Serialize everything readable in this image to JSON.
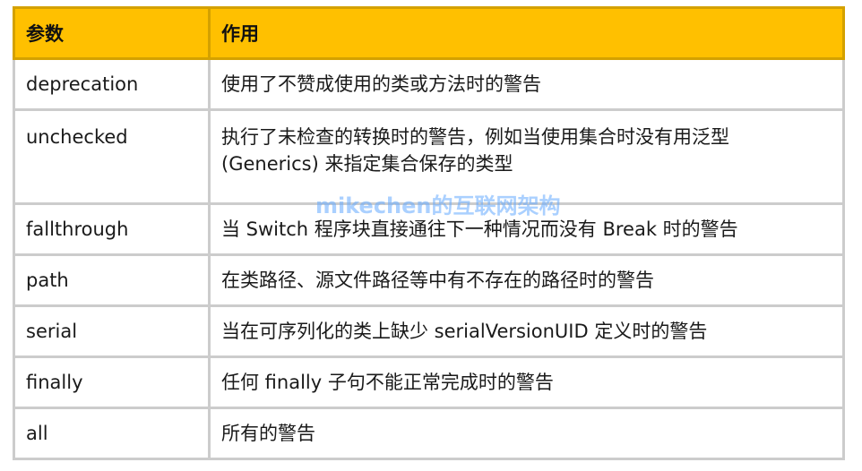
{
  "table": {
    "headers": [
      "参数",
      "作用"
    ],
    "rows": [
      {
        "param": "deprecation",
        "desc": "使用了不赞成使用的类或方法时的警告"
      },
      {
        "param": "unchecked",
        "desc": "执行了未检查的转换时的警告，例如当使用集合时没有用泛型 (Generics) 来指定集合保存的类型"
      },
      {
        "param": "fallthrough",
        "desc": "当 Switch 程序块直接通往下一种情况而没有 Break 时的警告"
      },
      {
        "param": "path",
        "desc": "在类路径、源文件路径等中有不存在的路径时的警告"
      },
      {
        "param": "serial",
        "desc": "当在可序列化的类上缺少 serialVersionUID 定义时的警告"
      },
      {
        "param": "finally",
        "desc": "任何 finally 子句不能正常完成时的警告"
      },
      {
        "param": "all",
        "desc": "所有的警告"
      }
    ]
  },
  "watermark": "mikechen的互联网架构",
  "colors": {
    "header_bg": "#FFC000",
    "border": "#cccccc"
  }
}
